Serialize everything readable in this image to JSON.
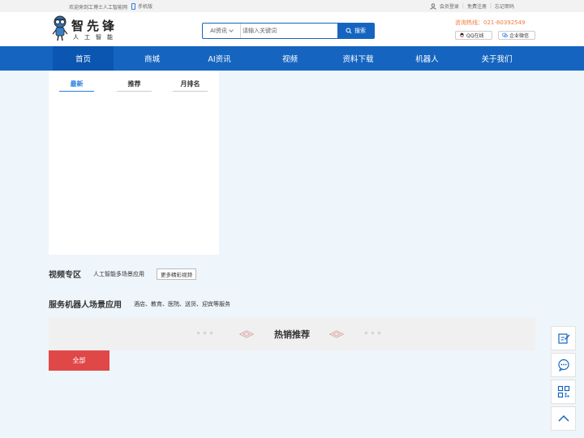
{
  "topbar": {
    "welcome": "欢迎来到工博士人工智能网",
    "mobile_label": "手机版",
    "login": "会员登录",
    "register": "免费注册",
    "forgot": "忘记密码",
    "sep": "|"
  },
  "logo": {
    "name": "智先锋",
    "subtitle": "人工智能"
  },
  "search": {
    "category": "AI资讯",
    "placeholder": "请输入关键词",
    "button": "搜索"
  },
  "contact": {
    "hotline": "咨询热线：021-80392549",
    "qq": "QQ在线",
    "wechat": "企业微信"
  },
  "nav": {
    "items": [
      "首页",
      "商城",
      "AI资讯",
      "视频",
      "资料下载",
      "机器人",
      "关于我们"
    ],
    "active_index": 0
  },
  "tabs": {
    "items": [
      "最新",
      "推荐",
      "月排名"
    ],
    "active_index": 0
  },
  "video_section": {
    "title": "视频专区",
    "desc": "人工智能多场景应用",
    "more": "更多精彩视频"
  },
  "robot_section": {
    "title": "服务机器人场景应用",
    "desc": "酒店、教育、医院、送货、迎宾等服务"
  },
  "hot": {
    "title": "热销推荐",
    "all_button": "全部"
  },
  "float_bar": {
    "icons": [
      "edit-icon",
      "chat-icon",
      "qrcode-icon",
      "back-to-top-icon"
    ]
  },
  "colors": {
    "primary": "#1565c0",
    "accent_orange": "#f07a3a",
    "red": "#e04848",
    "tab_active": "#2b7de0"
  }
}
